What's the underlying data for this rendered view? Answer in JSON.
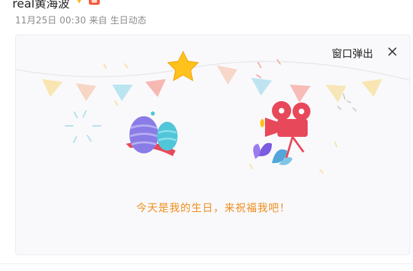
{
  "post": {
    "username": "real黄海波",
    "timestamp": "11月25日 00:30",
    "source_prefix": "来自",
    "source": "生日动态"
  },
  "card": {
    "popout_label": "窗口弹出",
    "close_icon": "close-icon",
    "message": "今天是我的生日，来祝福我吧！"
  },
  "colors": {
    "message": "#f08c1a",
    "flag_red": "#f6a29a",
    "flag_yellow": "#f7de9a",
    "flag_blue": "#a6dced",
    "star": "#ffc21c",
    "egg_purple": "#8a7ce6",
    "egg_teal": "#52c6d9",
    "ribbon": "#e8495a",
    "camera": "#e8495a"
  },
  "icons": [
    "verified-v-icon",
    "level-badge-icon",
    "star-icon",
    "easter-egg-icon",
    "movie-camera-icon",
    "leaf-icon",
    "close-icon"
  ]
}
